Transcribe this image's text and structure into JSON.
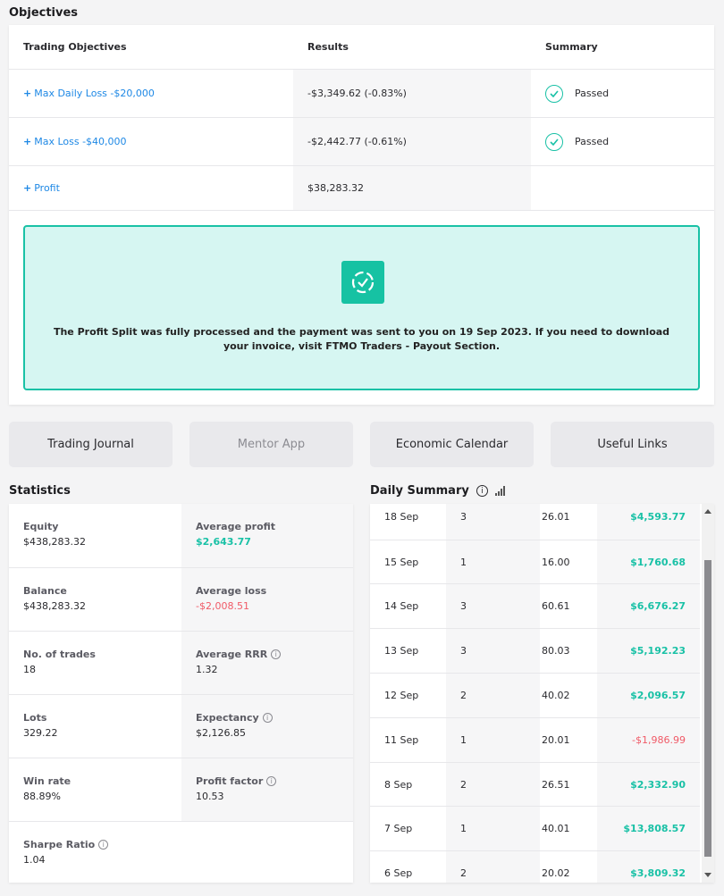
{
  "objectives": {
    "title": "Objectives",
    "headers": {
      "objective": "Trading Objectives",
      "results": "Results",
      "summary": "Summary"
    },
    "rows": [
      {
        "label": "Max Daily Loss -$20,000",
        "result": "-$3,349.62 (-0.83%)",
        "status": "Passed"
      },
      {
        "label": "Max Loss -$40,000",
        "result": "-$2,442.77 (-0.61%)",
        "status": "Passed"
      },
      {
        "label": "Profit",
        "result": "$38,283.32",
        "status": ""
      }
    ],
    "plus": "+",
    "payout_message": "The Profit Split was fully processed and the payment was sent to you on 19 Sep 2023. If you need to download your invoice, visit FTMO Traders - Payout Section."
  },
  "nav": {
    "buttons": [
      "Trading Journal",
      "Mentor App",
      "Economic Calendar",
      "Useful Links"
    ]
  },
  "statistics": {
    "title": "Statistics",
    "equity": {
      "label": "Equity",
      "value": "$438,283.32"
    },
    "avg_profit": {
      "label": "Average profit",
      "value": "$2,643.77"
    },
    "balance": {
      "label": "Balance",
      "value": "$438,283.32"
    },
    "avg_loss": {
      "label": "Average loss",
      "value": "-$2,008.51"
    },
    "trades": {
      "label": "No. of trades",
      "value": "18"
    },
    "avg_rrr": {
      "label": "Average RRR",
      "value": "1.32"
    },
    "lots": {
      "label": "Lots",
      "value": "329.22"
    },
    "expectancy": {
      "label": "Expectancy",
      "value": "$2,126.85"
    },
    "win_rate": {
      "label": "Win rate",
      "value": "88.89%"
    },
    "profit_factor": {
      "label": "Profit factor",
      "value": "10.53"
    },
    "sharpe": {
      "label": "Sharpe Ratio",
      "value": "1.04"
    },
    "info_glyph": "i"
  },
  "daily_summary": {
    "title": "Daily Summary",
    "info_glyph": "i",
    "rows": [
      {
        "date": "18 Sep",
        "trades": "3",
        "lots": "26.01",
        "result": "$4,593.77"
      },
      {
        "date": "15 Sep",
        "trades": "1",
        "lots": "16.00",
        "result": "$1,760.68"
      },
      {
        "date": "14 Sep",
        "trades": "3",
        "lots": "60.61",
        "result": "$6,676.27"
      },
      {
        "date": "13 Sep",
        "trades": "3",
        "lots": "80.03",
        "result": "$5,192.23"
      },
      {
        "date": "12 Sep",
        "trades": "2",
        "lots": "40.02",
        "result": "$2,096.57"
      },
      {
        "date": "11 Sep",
        "trades": "1",
        "lots": "20.01",
        "result": "-$1,986.99"
      },
      {
        "date": "8 Sep",
        "trades": "2",
        "lots": "26.51",
        "result": "$2,332.90"
      },
      {
        "date": "7 Sep",
        "trades": "1",
        "lots": "40.01",
        "result": "$13,808.57"
      },
      {
        "date": "6 Sep",
        "trades": "2",
        "lots": "20.02",
        "result": "$3,809.32"
      }
    ]
  },
  "colors": {
    "accent": "#19c1a6",
    "link": "#1e88e5",
    "negative": "#f05a67",
    "payout_bg": "#d6f6f2"
  }
}
